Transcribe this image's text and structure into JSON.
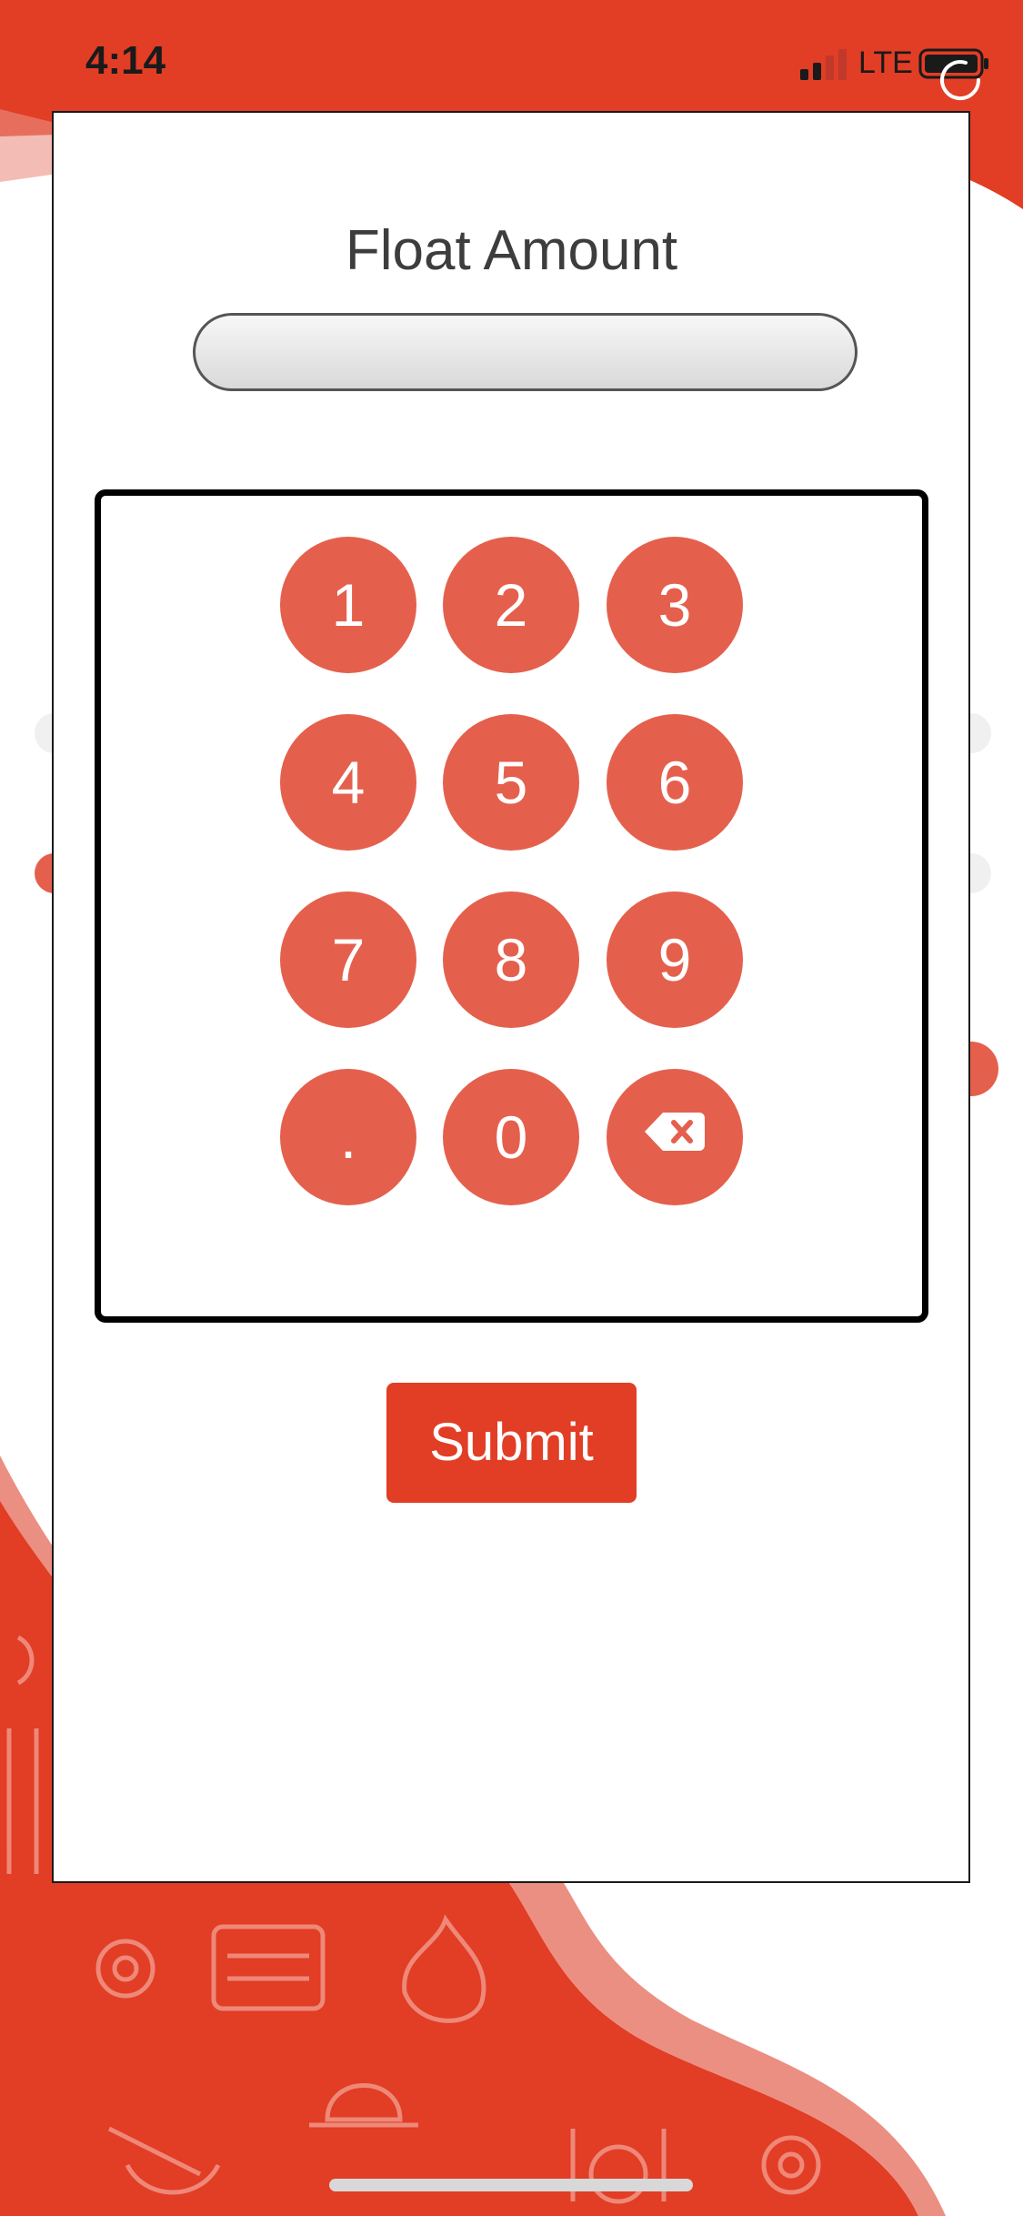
{
  "status_bar": {
    "time": "4:14",
    "network": "LTE"
  },
  "title": "Float Amount",
  "amount_field": {
    "value": ""
  },
  "keypad": {
    "keys": [
      "1",
      "2",
      "3",
      "4",
      "5",
      "6",
      "7",
      "8",
      "9",
      ".",
      "0"
    ],
    "delete_icon": "backspace-icon"
  },
  "submit_label": "Submit",
  "colors": {
    "brand_red": "#e23d25",
    "key_red": "#e4604d",
    "wave_light": "#eb8f82"
  }
}
